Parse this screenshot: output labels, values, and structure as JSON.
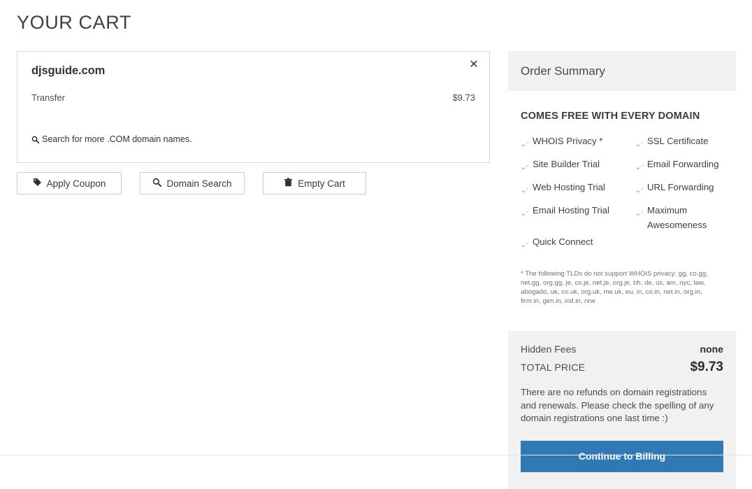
{
  "page": {
    "title": "YOUR CART"
  },
  "cart": {
    "item": {
      "domain": "djsguide.com",
      "type_label": "Transfer",
      "price": "$9.73",
      "remove_icon": "close-icon",
      "remove_glyph": "✕"
    },
    "search_link": {
      "icon": "search-icon",
      "label": "Search for more .COM domain names."
    },
    "actions": [
      {
        "label": "Apply Coupon",
        "icon": "tag-icon"
      },
      {
        "label": "Domain Search",
        "icon": "search-icon"
      },
      {
        "label": "Empty Cart",
        "icon": "trash-icon"
      }
    ]
  },
  "summary": {
    "heading": "Order Summary",
    "free_heading": "COMES FREE WITH EVERY DOMAIN",
    "features_left": [
      "WHOIS Privacy *",
      "Site Builder Trial",
      "Web Hosting Trial",
      "Email Hosting Trial",
      "Quick Connect"
    ],
    "features_right": [
      "SSL Certificate",
      "Email Forwarding",
      "URL Forwarding",
      "Maximum Awesomeness"
    ],
    "fine_print": "* The following TLDs do not support WHOIS privacy: gg, co.gg, net.gg, org.gg, je, co.je, net.je, org.je, bh, de, us, am, nyc, law, abogado, uk, co.uk, org.uk, me.uk, eu, in, co.in, net.in, org.in, firm.in, gen.in, ind.in, nrw",
    "totals": {
      "hidden_fees_label": "Hidden Fees",
      "hidden_fees_value": "none",
      "total_label": "TOTAL PRICE",
      "total_value": "$9.73"
    },
    "refund_text": "There are no refunds on domain registrations and renewals. Please check the spelling of any domain registrations one last time :)",
    "continue_label": "Continue to Billing"
  },
  "colors": {
    "primary_button": "#3079b5",
    "panel_gray": "#f1f1f1",
    "border_gray": "#d6d6d6",
    "check_gray": "#a9a9a9"
  }
}
